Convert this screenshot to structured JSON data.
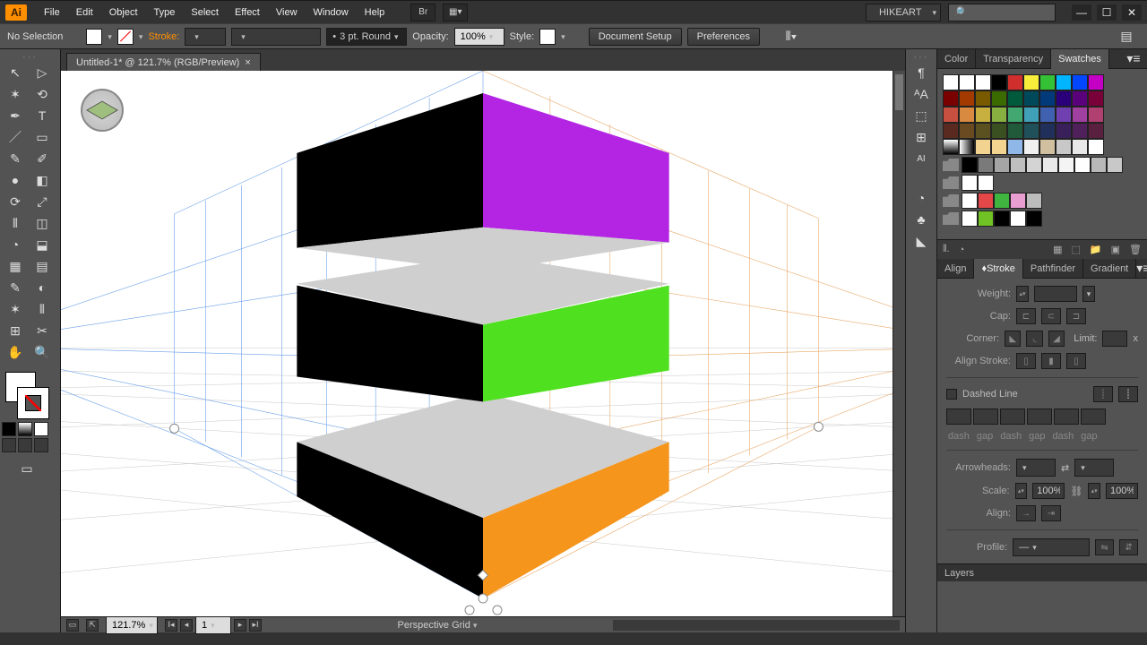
{
  "app": {
    "logo": "Ai"
  },
  "menu": [
    "File",
    "Edit",
    "Object",
    "Type",
    "Select",
    "Effect",
    "View",
    "Window",
    "Help"
  ],
  "user": "HIKEART",
  "search": {
    "placeholder": ""
  },
  "controlbar": {
    "selection": "No Selection",
    "stroke_label": "Stroke:",
    "stroke_weight": "",
    "brush_preset": "",
    "variable_width_profile": "3 pt. Round",
    "opacity_label": "Opacity:",
    "opacity_value": "100%",
    "style_label": "Style:",
    "doc_setup": "Document Setup",
    "preferences": "Preferences"
  },
  "document": {
    "tab": "Untitled-1* @ 121.7% (RGB/Preview)",
    "close": "×"
  },
  "status": {
    "zoom": "121.7%",
    "artboard": "1",
    "tool": "Perspective Grid"
  },
  "panels": {
    "color_tabs": [
      "Color",
      "Transparency",
      "Swatches"
    ],
    "stroke_tabs": [
      "Align",
      "Stroke",
      "Pathfinder",
      "Gradient"
    ],
    "layers_tab": "Layers",
    "stroke": {
      "weight": "Weight:",
      "cap": "Cap:",
      "corner": "Corner:",
      "limit": "Limit:",
      "limit_x": "x",
      "align_stroke": "Align Stroke:",
      "dashed": "Dashed Line",
      "dash_labels": [
        "dash",
        "gap",
        "dash",
        "gap",
        "dash",
        "gap"
      ],
      "arrowheads": "Arrowheads:",
      "scale": "Scale:",
      "scale_v1": "100%",
      "scale_v2": "100%",
      "align": "Align:",
      "profile": "Profile:"
    }
  },
  "swatches": {
    "row1": [
      "#ffffff",
      "#ffffff",
      "#ffffff",
      "#000000",
      "#d12e2e",
      "#f7ee3b",
      "#35c135",
      "#00b5ff",
      "#0047ff",
      "#c400c4"
    ],
    "row2": [
      "#7a0000",
      "#a33b00",
      "#7a5a00",
      "#3b6b00",
      "#005a3b",
      "#00495a",
      "#003a7a",
      "#2a007a",
      "#5a007a",
      "#7a003a"
    ],
    "row3": [
      "#c85040",
      "#d88a40",
      "#c8b040",
      "#88b040",
      "#40a870",
      "#40a0b8",
      "#4060b0",
      "#7040b0",
      "#a040a0",
      "#b04070"
    ],
    "row4": [
      "#5a2a20",
      "#6a4a20",
      "#5a5020",
      "#3a5020",
      "#205a3a",
      "#20505a",
      "#20305a",
      "#3a205a",
      "#50205a",
      "#5a2040"
    ],
    "gradients": [
      "linear-gradient(#fff,#000)",
      "linear-gradient(90deg,#fff,#000)",
      "#f2d490",
      "#f2d490",
      "#8fb8e8",
      "#f0f0f0",
      "#d0c0a0",
      "#c8c8c8",
      "#e8e8e8",
      "#fff"
    ],
    "group1": [
      "#000",
      "#7a7a7a",
      "#a5a5a5",
      "#bfbfbf",
      "#d4d4d4",
      "#e8e8e8",
      "#f4f4f4",
      "#fff",
      "#b8b8b8",
      "#c8c8c8"
    ],
    "group2": [
      "#fff",
      "#fff"
    ],
    "group3": [
      "#fff",
      "#e34747",
      "#3fb43f",
      "#e89ed0",
      "#bcbcbc"
    ],
    "group4": [
      "#fff",
      "#71c224",
      "#000",
      "#fff",
      "#000"
    ]
  },
  "shapes": {
    "left": "#000000",
    "right_top": "#b324e3",
    "right_mid": "#4fe01f",
    "right_bot": "#f5951b",
    "floor": "#cfcfcf"
  },
  "tools_left": [
    "↖",
    "⬛",
    "✶",
    "⤢",
    "✒",
    "T",
    "／",
    "▭",
    "✎",
    "⬈",
    "⌫",
    "◐",
    "✂",
    "⟲",
    "◧",
    "▤",
    "⬚",
    "▦",
    "◉",
    "⬓",
    "▥",
    "⫴",
    "⊞",
    "✎",
    "⊡",
    "⬚",
    "✋",
    "🔍"
  ],
  "tools_right": [
    "¶",
    "ᴬA",
    "⬚",
    "⊞",
    "AI",
    "◔",
    "♣",
    "◣"
  ]
}
